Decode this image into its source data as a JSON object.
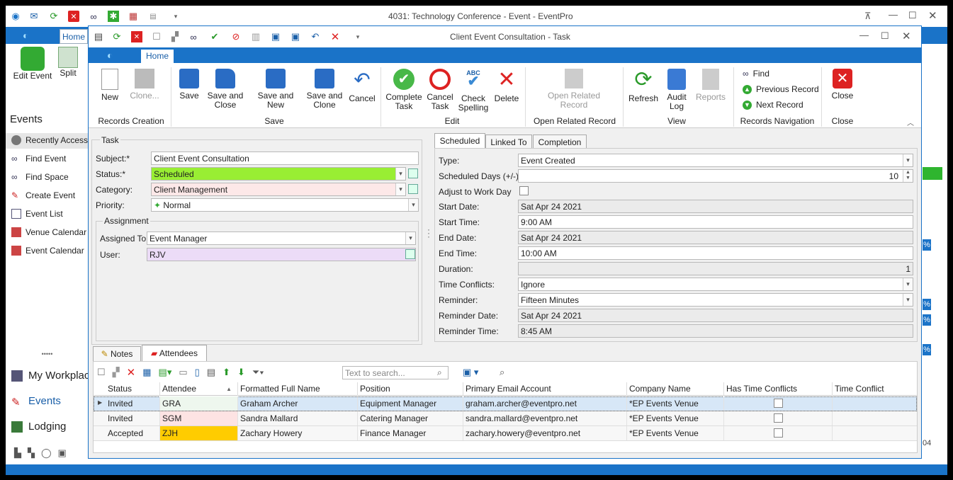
{
  "outer": {
    "title": "4031: Technology Conference - Event - EventPro",
    "home_tab": "Home",
    "edit_event": "Edit Event",
    "split": "Split"
  },
  "sidebar": {
    "header": "Events",
    "items": [
      {
        "label": "Recently Accessed"
      },
      {
        "label": "Find Event"
      },
      {
        "label": "Find Space"
      },
      {
        "label": "Create Event"
      },
      {
        "label": "Event List"
      },
      {
        "label": "Venue Calendar"
      },
      {
        "label": "Event Calendar"
      }
    ],
    "big": [
      {
        "label": "My Workplace"
      },
      {
        "label": "Events"
      },
      {
        "label": "Lodging"
      }
    ]
  },
  "dialog": {
    "title": "Client Event Consultation - Task",
    "home_tab": "Home",
    "ribbon": {
      "new": "New",
      "clone": "Clone...",
      "save": "Save",
      "save_close": "Save and Close",
      "save_new": "Save and New",
      "save_clone": "Save and Clone",
      "cancel": "Cancel",
      "complete": "Complete Task",
      "cancel_task": "Cancel Task",
      "check_spelling": "Check Spelling",
      "spell_abc": "ABC",
      "delete": "Delete",
      "open_related": "Open Related Record",
      "refresh": "Refresh",
      "audit": "Audit Log",
      "reports": "Reports",
      "find": "Find",
      "prev": "Previous Record",
      "next": "Next Record",
      "close": "Close"
    },
    "groups": {
      "records_creation": "Records Creation",
      "save": "Save",
      "edit": "Edit",
      "open_related": "Open Related Record",
      "view": "View",
      "nav": "Records Navigation",
      "close": "Close"
    }
  },
  "task": {
    "section": "Task",
    "subject_label": "Subject:*",
    "subject": "Client Event Consultation",
    "status_label": "Status:*",
    "status": "Scheduled",
    "status_color": "#99ee33",
    "category_label": "Category:",
    "category": "Client Management",
    "category_color": "#fde8e8",
    "priority_label": "Priority:",
    "priority": "Normal",
    "assignment": "Assignment",
    "assigned_to_label": "Assigned To:",
    "assigned_to": "Event Manager",
    "user_label": "User:",
    "user": "RJV",
    "user_color": "#ecdcf7"
  },
  "schedule": {
    "tabs": [
      "Scheduled",
      "Linked To",
      "Completion"
    ],
    "type_label": "Type:",
    "type": "Event Created",
    "days_label": "Scheduled Days (+/-):",
    "days": "10",
    "adjust_label": "Adjust to Work Day",
    "start_date_label": "Start Date:",
    "start_date": "Sat Apr 24 2021",
    "start_time_label": "Start Time:",
    "start_time": "9:00 AM",
    "end_date_label": "End Date:",
    "end_date": "Sat Apr 24 2021",
    "end_time_label": "End Time:",
    "end_time": "10:00 AM",
    "duration_label": "Duration:",
    "duration": "1",
    "conflicts_label": "Time Conflicts:",
    "conflicts": "Ignore",
    "reminder_label": "Reminder:",
    "reminder": "Fifteen Minutes",
    "reminder_date_label": "Reminder Date:",
    "reminder_date": "Sat Apr 24 2021",
    "reminder_time_label": "Reminder Time:",
    "reminder_time": "8:45 AM"
  },
  "bottom": {
    "tabs": [
      "Notes",
      "Attendees"
    ],
    "search_placeholder": "Text to search...",
    "columns": [
      "Status",
      "Attendee",
      "Formatted Full Name",
      "Position",
      "Primary Email Account",
      "Company Name",
      "Has Time Conflicts",
      "Time Conflict"
    ],
    "rows": [
      {
        "status": "Invited",
        "attendee": "GRA",
        "color": "#eef7ee",
        "name": "Graham Archer",
        "position": "Equipment Manager",
        "email": "graham.archer@eventpro.net",
        "company": "*EP Events Venue"
      },
      {
        "status": "Invited",
        "attendee": "SGM",
        "color": "#fde3e3",
        "name": "Sandra Mallard",
        "position": "Catering Manager",
        "email": "sandra.mallard@eventpro.net",
        "company": "*EP Events Venue"
      },
      {
        "status": "Accepted",
        "attendee": "ZJH",
        "color": "#ffcc00",
        "name": "Zachary Howery",
        "position": "Finance Manager",
        "email": "zachary.howery@eventpro.net",
        "company": "*EP Events Venue"
      }
    ]
  },
  "right_strip": {
    "pct": "%",
    "num": "04"
  }
}
